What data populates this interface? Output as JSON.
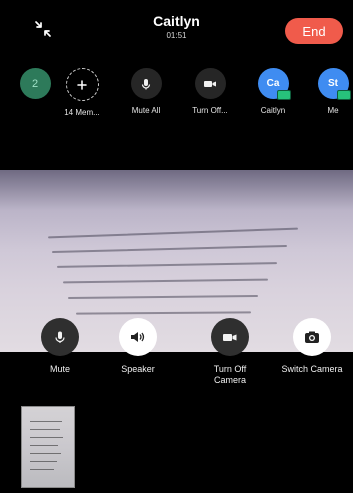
{
  "call": {
    "name": "Caitlyn",
    "duration": "01:51",
    "end_label": "End"
  },
  "participants_strip": {
    "count_badge": "2",
    "items": [
      {
        "label": "14 Mem...",
        "icon": "plus-icon"
      },
      {
        "label": "Mute All",
        "icon": "microphone-icon"
      },
      {
        "label": "Turn Off...",
        "icon": "video-camera-icon"
      },
      {
        "label": "Caitlyn",
        "avatar_text": "Ca"
      },
      {
        "label": "Me",
        "avatar_text": "St"
      }
    ]
  },
  "controls": [
    {
      "label": "Mute",
      "icon": "microphone-icon"
    },
    {
      "label": "Speaker",
      "icon": "speaker-icon"
    },
    {
      "label": "Turn Off\nCamera",
      "icon": "video-camera-icon"
    },
    {
      "label": "Switch Camera",
      "icon": "camera-icon"
    }
  ],
  "colors": {
    "end_button": "#f05b4b",
    "avatar_blue": "#3f8cf1",
    "status_green": "#27c17b"
  }
}
